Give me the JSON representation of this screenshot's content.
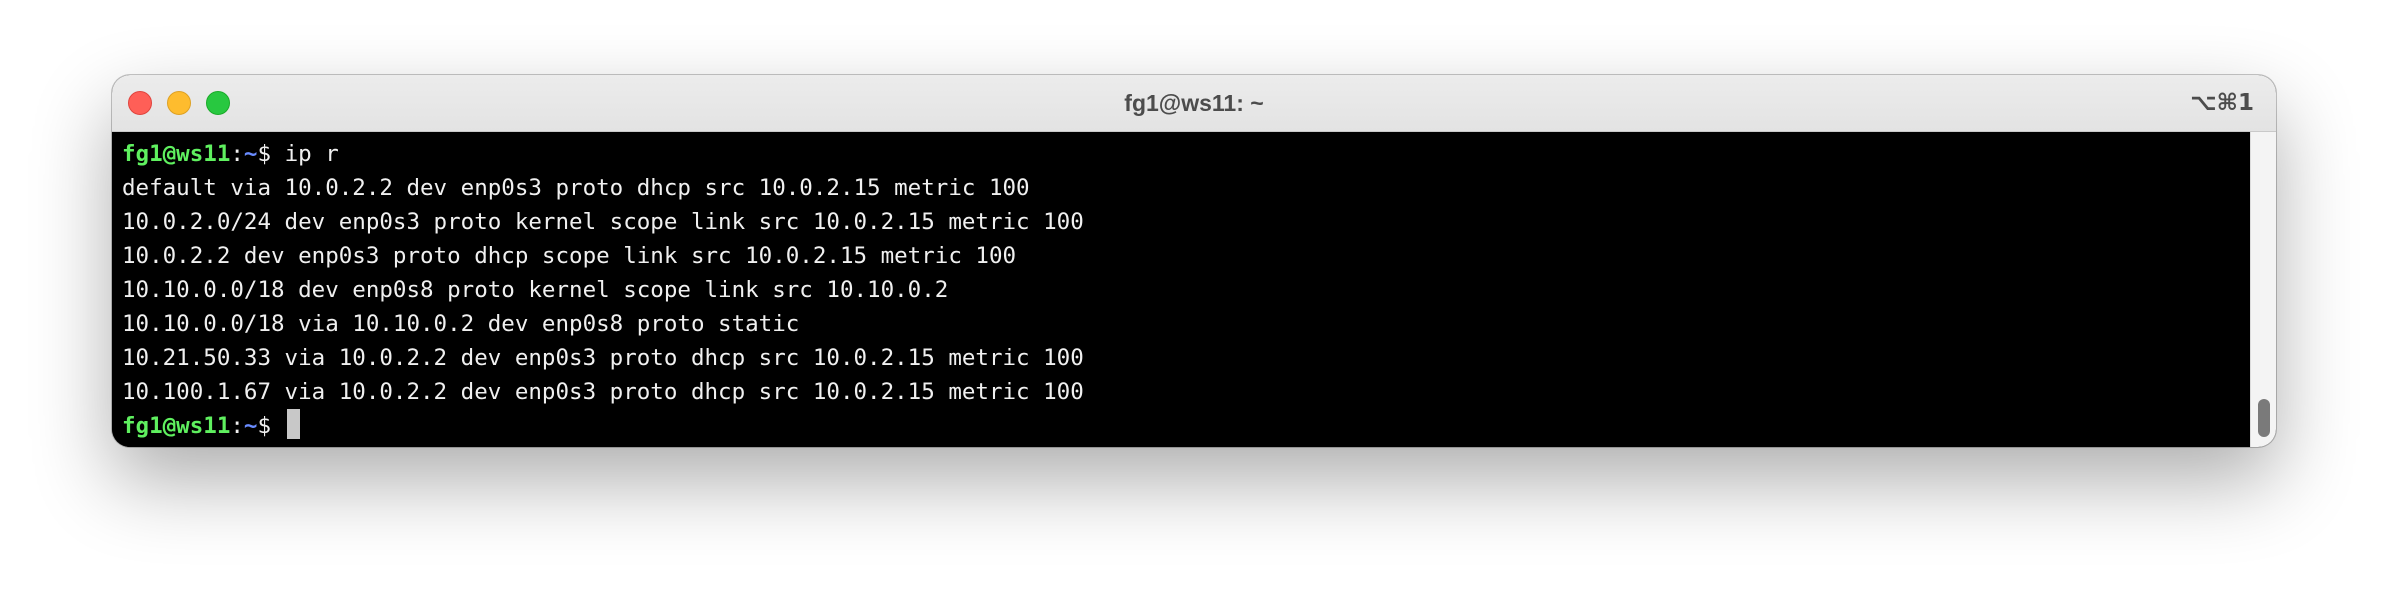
{
  "window": {
    "title": "fg1@ws11: ~",
    "shortcut": "⌥⌘1"
  },
  "terminal": {
    "prompt_user": "fg1@ws11",
    "prompt_sep": ":",
    "prompt_path": "~",
    "prompt_symbol": "$ ",
    "command": "ip r",
    "output": [
      "default via 10.0.2.2 dev enp0s3 proto dhcp src 10.0.2.15 metric 100",
      "10.0.2.0/24 dev enp0s3 proto kernel scope link src 10.0.2.15 metric 100",
      "10.0.2.2 dev enp0s3 proto dhcp scope link src 10.0.2.15 metric 100",
      "10.10.0.0/18 dev enp0s8 proto kernel scope link src 10.10.0.2",
      "10.10.0.0/18 via 10.10.0.2 dev enp0s8 proto static",
      "10.21.50.33 via 10.0.2.2 dev enp0s3 proto dhcp src 10.0.2.15 metric 100",
      "10.100.1.67 via 10.0.2.2 dev enp0s3 proto dhcp src 10.0.2.15 metric 100"
    ]
  },
  "colors": {
    "prompt_user": "#5ff05f",
    "prompt_path": "#6a8cff",
    "terminal_bg": "#000000",
    "terminal_fg": "#f0f0f0"
  }
}
